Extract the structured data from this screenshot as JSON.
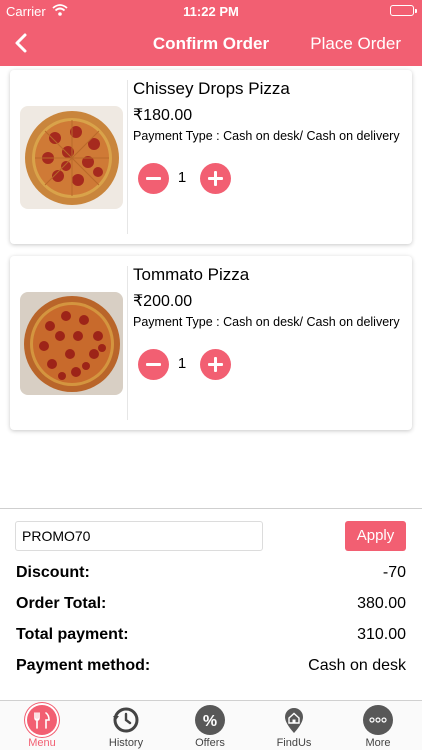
{
  "status": {
    "carrier": "Carrier",
    "time": "11:22 PM"
  },
  "nav": {
    "title": "Confirm Order",
    "action": "Place Order"
  },
  "items": [
    {
      "name": "Chissey Drops Pizza",
      "price": "₹180.00",
      "payment_type": "Payment Type : Cash on desk/ Cash on delivery",
      "qty": "1"
    },
    {
      "name": "Tommato Pizza",
      "price": "₹200.00",
      "payment_type": "Payment Type : Cash on desk/ Cash on delivery",
      "qty": "1"
    }
  ],
  "promo": {
    "value": "PROMO70",
    "apply_label": "Apply"
  },
  "summary": {
    "discount_label": "Discount:",
    "discount_value": "-70",
    "order_total_label": "Order Total:",
    "order_total_value": "380.00",
    "total_payment_label": "Total payment:",
    "total_payment_value": "310.00",
    "payment_method_label": "Payment method:",
    "payment_method_value": "Cash on desk"
  },
  "tabs": [
    {
      "label": "Menu",
      "icon": "menu-icon",
      "active": true
    },
    {
      "label": "History",
      "icon": "history-icon",
      "active": false
    },
    {
      "label": "Offers",
      "icon": "offers-icon",
      "active": false
    },
    {
      "label": "FindUs",
      "icon": "findus-icon",
      "active": false
    },
    {
      "label": "More",
      "icon": "more-icon",
      "active": false
    }
  ],
  "colors": {
    "accent": "#f25f72",
    "tab_icon": "#585858"
  }
}
